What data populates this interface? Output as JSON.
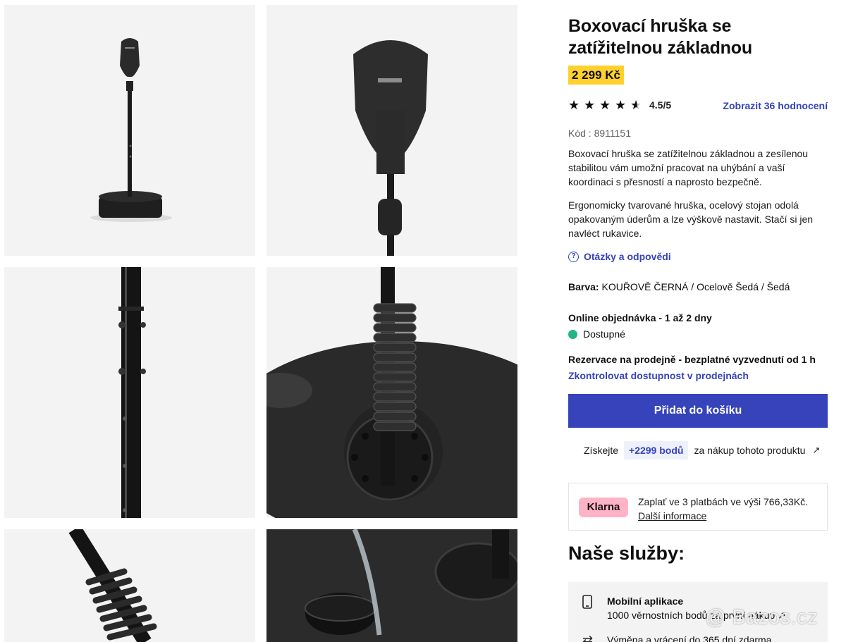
{
  "product": {
    "title": "Boxovací hruška se zatížitelnou základnou",
    "price": "2 299 Kč",
    "rating_stars": 4.5,
    "rating_text": "4.5/5",
    "reviews_link": "Zobrazit 36 hodnocení",
    "code": "Kód : 8911151",
    "description_1": "Boxovací hruška se zatížitelnou základnou a zesílenou stabilitou vám umožní pracovat na uhýbání a vaší koordinaci s přesností a naprosto bezpečně.",
    "description_2": "Ergonomicky tvarované hruška, ocelový stojan odolá opakovaným úderům a lze výškově nastavit. Stačí si jen navléct rukavice.",
    "qa_link": "Otázky a odpovědi",
    "color_label": "Barva:",
    "color_value": " KOUŘOVĚ ČERNÁ / Ocelově Šedá / Šedá",
    "online_order": "Online objednávka - 1 až 2 dny",
    "availability": "Dostupné",
    "store_reservation": "Rezervace na prodejně - bezplatné vyzvednutí od 1 h",
    "check_stores": "Zkontrolovat dostupnost v prodejnách",
    "add_to_cart": "Přidat do košíku",
    "points_prefix": "Získejte",
    "points_badge": "+2299 bodů",
    "points_suffix": "za nákup tohoto produktu"
  },
  "klarna": {
    "logo": "Klarna",
    "text": "Zaplať ve 3 platbách ve výši 766,33Kč.",
    "more": "Další informace"
  },
  "services": {
    "title": "Naše služby:",
    "items": [
      {
        "title": "Mobilní aplikace",
        "text": "1000 věrnostních bodů za první nákup"
      },
      {
        "title": "Výměna a vrácení do 365 dní zdarma",
        "text": ""
      }
    ]
  },
  "watermark": "@ Bazos.cz",
  "icons": {
    "star": "star-icon",
    "half_star": "half-star-icon",
    "question": "question-circle-icon",
    "external": "external-link-icon",
    "phone": "phone-icon",
    "return": "return-icon"
  },
  "colors": {
    "accent": "#3643ba",
    "price_bg": "#ffd02e",
    "available": "#23b680",
    "klarna_pink": "#ffb3c7"
  }
}
